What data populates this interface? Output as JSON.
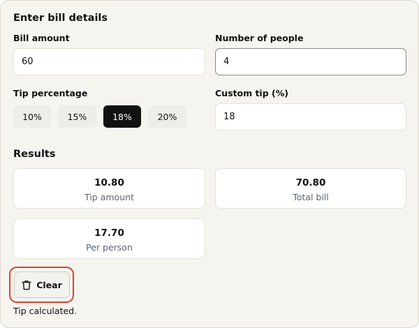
{
  "details": {
    "title": "Enter bill details",
    "bill_amount": {
      "label": "Bill amount",
      "value": "60"
    },
    "people": {
      "label": "Number of people",
      "value": "4"
    },
    "tip": {
      "label": "Tip percentage",
      "options": [
        "10%",
        "15%",
        "18%",
        "20%"
      ],
      "selected": "18%"
    },
    "custom_tip": {
      "label": "Custom tip (%)",
      "value": "18"
    }
  },
  "results": {
    "title": "Results",
    "tip_amount": {
      "value": "10.80",
      "label": "Tip amount"
    },
    "total_bill": {
      "value": "70.80",
      "label": "Total bill"
    },
    "per_person": {
      "value": "17.70",
      "label": "Per person"
    }
  },
  "actions": {
    "clear_label": "Clear",
    "clear_icon": "trash-icon"
  },
  "status": {
    "message": "Tip calculated."
  },
  "colors": {
    "accent": "#121212",
    "highlight": "#d9452e",
    "panel_bg": "#f6f4ef",
    "muted_text": "#5a6270"
  }
}
